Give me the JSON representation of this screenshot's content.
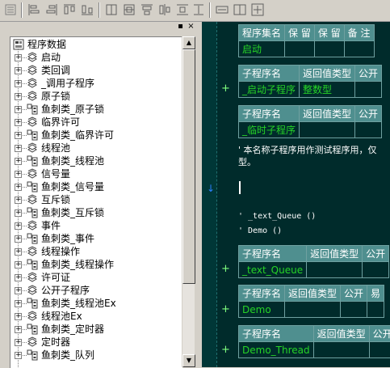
{
  "toolbar": {
    "buttons": [
      "align-left-icon",
      "align-center-icon",
      "align-right-icon",
      "distribute-h-icon",
      "same-width-icon",
      "same-height-icon",
      "same-size-icon",
      "align-top-icon",
      "align-middle-icon",
      "align-bottom-icon",
      "space-h-icon",
      "space-v-icon",
      "center-both-icon"
    ]
  },
  "panel": {
    "pin_label": "▪",
    "close_label": "×"
  },
  "tree": {
    "root": "程序数据",
    "items": [
      {
        "label": "启动",
        "icon": "module-icon"
      },
      {
        "label": "类回调",
        "icon": "module-icon"
      },
      {
        "label": "_调用子程序",
        "icon": "module-icon"
      },
      {
        "label": "原子锁",
        "icon": "module-icon"
      },
      {
        "label": "鱼刺类_原子锁",
        "icon": "class-icon"
      },
      {
        "label": "临界许可",
        "icon": "module-icon"
      },
      {
        "label": "鱼刺类_临界许可",
        "icon": "class-icon"
      },
      {
        "label": "线程池",
        "icon": "module-icon"
      },
      {
        "label": "鱼刺类_线程池",
        "icon": "class-icon"
      },
      {
        "label": "信号量",
        "icon": "module-icon"
      },
      {
        "label": "鱼刺类_信号量",
        "icon": "class-icon"
      },
      {
        "label": "互斥锁",
        "icon": "module-icon"
      },
      {
        "label": "鱼刺类_互斥锁",
        "icon": "class-icon"
      },
      {
        "label": "事件",
        "icon": "module-icon"
      },
      {
        "label": "鱼刺类_事件",
        "icon": "class-icon"
      },
      {
        "label": "线程操作",
        "icon": "module-icon"
      },
      {
        "label": "鱼刺类_线程操作",
        "icon": "class-icon"
      },
      {
        "label": "许可证",
        "icon": "module-icon"
      },
      {
        "label": "公开子程序",
        "icon": "module-icon"
      },
      {
        "label": "鱼刺类_线程池Ex",
        "icon": "class-icon"
      },
      {
        "label": "线程池Ex",
        "icon": "module-icon"
      },
      {
        "label": "鱼刺类_定时器",
        "icon": "class-icon"
      },
      {
        "label": "定时器",
        "icon": "module-icon"
      },
      {
        "label": "鱼刺类_队列",
        "icon": "class-icon"
      }
    ]
  },
  "editor": {
    "set_table": {
      "headers": [
        "程序集名",
        "保 留",
        "保 留",
        "备 注"
      ],
      "values": [
        "启动",
        "",
        "",
        ""
      ]
    },
    "sub1": {
      "headers": [
        "子程序名",
        "返回值类型",
        "公开"
      ],
      "values": [
        "_启动子程序",
        "整数型",
        ""
      ],
      "plus": "+"
    },
    "sub2": {
      "headers": [
        "子程序名",
        "返回值类型",
        "公开"
      ],
      "values": [
        "_临时子程序",
        "",
        ""
      ]
    },
    "comment1": "' 本名称子程序用作测试程序用，仅",
    "comment2": "型。",
    "arrow": "↓",
    "code1": "' _text_Queue ()",
    "code2": "' Demo ()",
    "sub3": {
      "headers": [
        "子程序名",
        "返回值类型",
        "公开"
      ],
      "values": [
        "_text_Queue",
        "",
        ""
      ],
      "plus": "+"
    },
    "sub4": {
      "headers": [
        "子程序名",
        "返回值类型",
        "公开",
        "易"
      ],
      "values": [
        "Demo",
        "",
        "",
        ""
      ],
      "plus": "+"
    },
    "sub5": {
      "headers": [
        "子程序名",
        "返回值类型",
        "公开"
      ],
      "values": [
        "Demo_Thread",
        "",
        ""
      ],
      "plus": "+"
    }
  }
}
